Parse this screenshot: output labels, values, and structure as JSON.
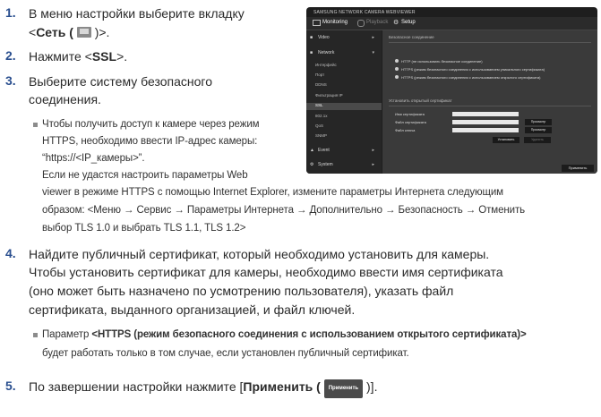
{
  "steps": {
    "s1": {
      "num": "1.",
      "text_a": "В меню настройки выберите вкладку",
      "text_b_open": "<",
      "text_b_bold": "Сеть (",
      "text_b_close": ")>."
    },
    "s2": {
      "num": "2.",
      "text_open": "Нажмите <",
      "text_bold": "SSL",
      "text_close": ">."
    },
    "s3": {
      "num": "3.",
      "text_a": "Выберите систему безопасного",
      "text_b": "соединения."
    },
    "note3": [
      "Чтобы получить доступ к камере через режим",
      "HTTPS, необходимо ввести IP-адрес камеры:",
      "“https://<IP_камеры>”.",
      "Если не удастся настроить параметры Web",
      "viewer в режиме HTTPS с помощью Internet Explorer, измените параметры Интернета следующим",
      "образом: <Меню → Сервис → Параметры Интернета → Дополнительно → Безопасность → Отменить",
      "выбор TLS 1.0 и выбрать TLS 1.1, TLS 1.2>"
    ],
    "s4": {
      "num": "4.",
      "lines": [
        "Найдите публичный сертификат, который необходимо установить для камеры.",
        "Чтобы установить сертификат для камеры, необходимо ввести имя сертификата",
        "(оно может быть назначено по усмотрению пользователя), указать файл",
        "сертификата, выданного организацией, и файл ключей."
      ]
    },
    "note4": {
      "prefix": "Параметр ",
      "bold": "<HTTPS (режим безопасного соединения с использованием открытого сертификата)>",
      "line2": "будет работать только в том случае, если установлен публичный сертификат."
    },
    "s5": {
      "num": "5.",
      "text_open": "По завершении настройки нажмите [",
      "text_bold": "Применить (",
      "btn": "Применить",
      "text_close": ")]."
    }
  },
  "screenshot": {
    "brand": "SAMSUNG NETWORK CAMERA WEBVIEWER",
    "tabs": {
      "monitoring": "Monitoring",
      "playback": "Playback",
      "setup": "Setup"
    },
    "sidebar": {
      "video": "Video",
      "network": "Network",
      "subs": [
        "Интерфейс",
        "Порт",
        "DDNS",
        "Фильтрация IP",
        "SSL",
        "802.1x",
        "QoS",
        "SNMP"
      ],
      "event": "Event",
      "system": "System"
    },
    "section1": "Безопасное соединение",
    "radios": [
      "HTTP (не использовать безопасное соединение)",
      "HTTPS (режим безопасного соединения с использованием уникального сертификата)",
      "HTTPS (режим безопасного соединения с использованием открытого сертификата)"
    ],
    "section2": "Установить открытый сертификат",
    "fields": {
      "name": "Имя сертификата",
      "file": "Файл сертификата",
      "key": "Файл ключа"
    },
    "buttons": {
      "browse1": "Просмотр",
      "browse2": "Просмотр",
      "install": "Установить",
      "delete": "Удалить",
      "apply": "Применить"
    }
  }
}
